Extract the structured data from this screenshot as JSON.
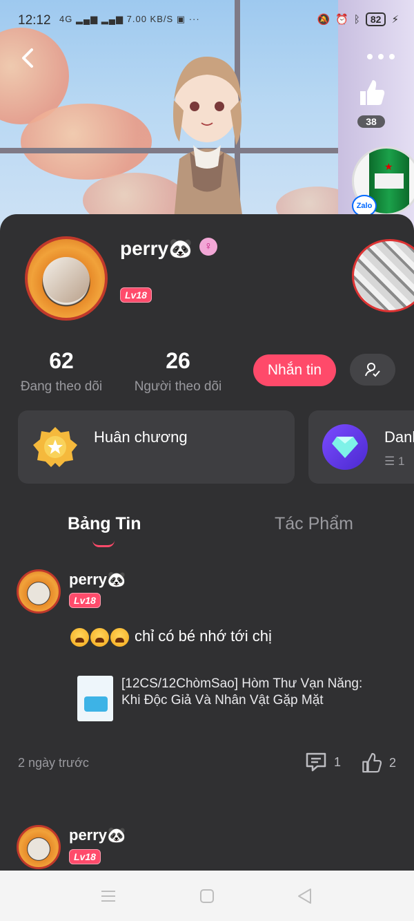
{
  "status_bar": {
    "time": "12:12",
    "network_speed": "7.00 KB/S",
    "signal_text": "4G",
    "more": "···",
    "battery": "82"
  },
  "header": {
    "like_count": "38",
    "zalo_label": "Zalo"
  },
  "profile": {
    "username": "perry🐼",
    "gender_symbol": "♀",
    "level": "Lv18",
    "stats": [
      {
        "value": "62",
        "label": "Đang theo dõi"
      },
      {
        "value": "26",
        "label": "Người theo dõi"
      }
    ],
    "message_button": "Nhắn tin"
  },
  "cards": {
    "medal_label": "Huân chương",
    "list_label": "Danh",
    "list_count": "☰ 1"
  },
  "tabs": [
    {
      "label": "Bảng Tin",
      "active": true
    },
    {
      "label": "Tác Phẩm",
      "active": false
    }
  ],
  "feed": {
    "post1": {
      "author": "perry🐼",
      "level": "Lv18",
      "text": "chỉ có bé nhớ tới chị",
      "article_title": "[12CS/12ChòmSao] Hòm Thư Vạn Năng: Khi Độc Giả Và Nhân Vật Gặp Mặt",
      "time": "2 ngày trước",
      "comment_count": "1",
      "like_count": "2"
    },
    "post2": {
      "author": "perry🐼",
      "level": "Lv18"
    }
  },
  "colors": {
    "accent": "#ff4a6a",
    "background": "#303032",
    "card": "#3e3e41"
  }
}
